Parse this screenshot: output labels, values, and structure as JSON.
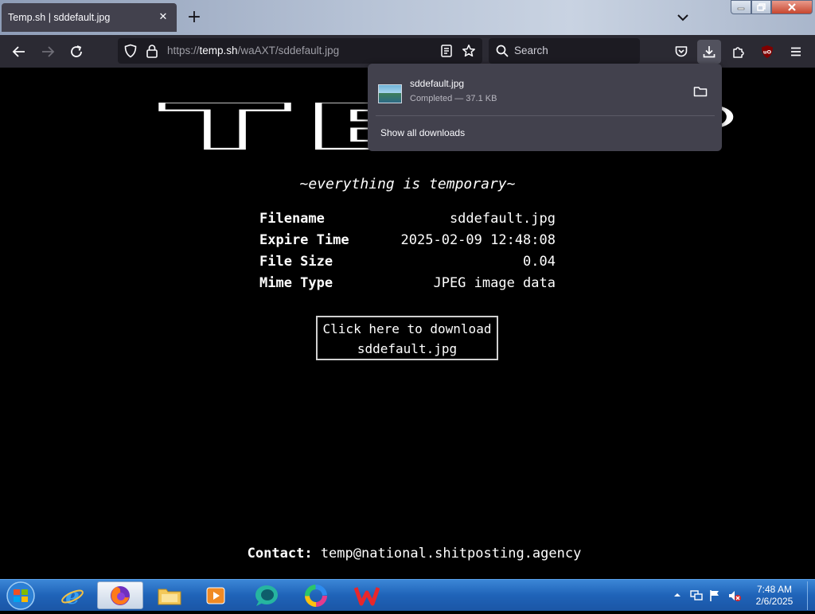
{
  "browser": {
    "tab_title": "Temp.sh | sddefault.jpg",
    "tab_close": "✕",
    "new_tab": "+",
    "url_scheme": "https://",
    "url_host": "temp.sh",
    "url_path": "/waAXT/sddefault.jpg",
    "search_placeholder": "Search",
    "ublock_badge": "uO"
  },
  "downloads_panel": {
    "filename": "sddefault.jpg",
    "status": "Completed — 37.1 KB",
    "show_all": "Show all downloads"
  },
  "page": {
    "logo_text": "TEMP",
    "tagline": "~everything is temporary~",
    "info": [
      {
        "label": "Filename",
        "value": "sddefault.jpg"
      },
      {
        "label": "Expire Time",
        "value": "2025-02-09 12:48:08"
      },
      {
        "label": "File Size",
        "value": "0.04"
      },
      {
        "label": "Mime Type",
        "value": "JPEG image data"
      }
    ],
    "download_line1": "Click here to download",
    "download_line2": "sddefault.jpg",
    "contact_label": "Contact:",
    "contact_email": "temp@national.shitposting.agency"
  },
  "taskbar": {
    "time": "7:48 AM",
    "date": "2/6/2025"
  },
  "colors": {
    "page_bg": "#000000",
    "toolbar_bg": "#2b2a33",
    "urlbar_bg": "#1c1b22",
    "panel_bg": "#42414d",
    "taskbar_blue": "#1f63b8"
  }
}
